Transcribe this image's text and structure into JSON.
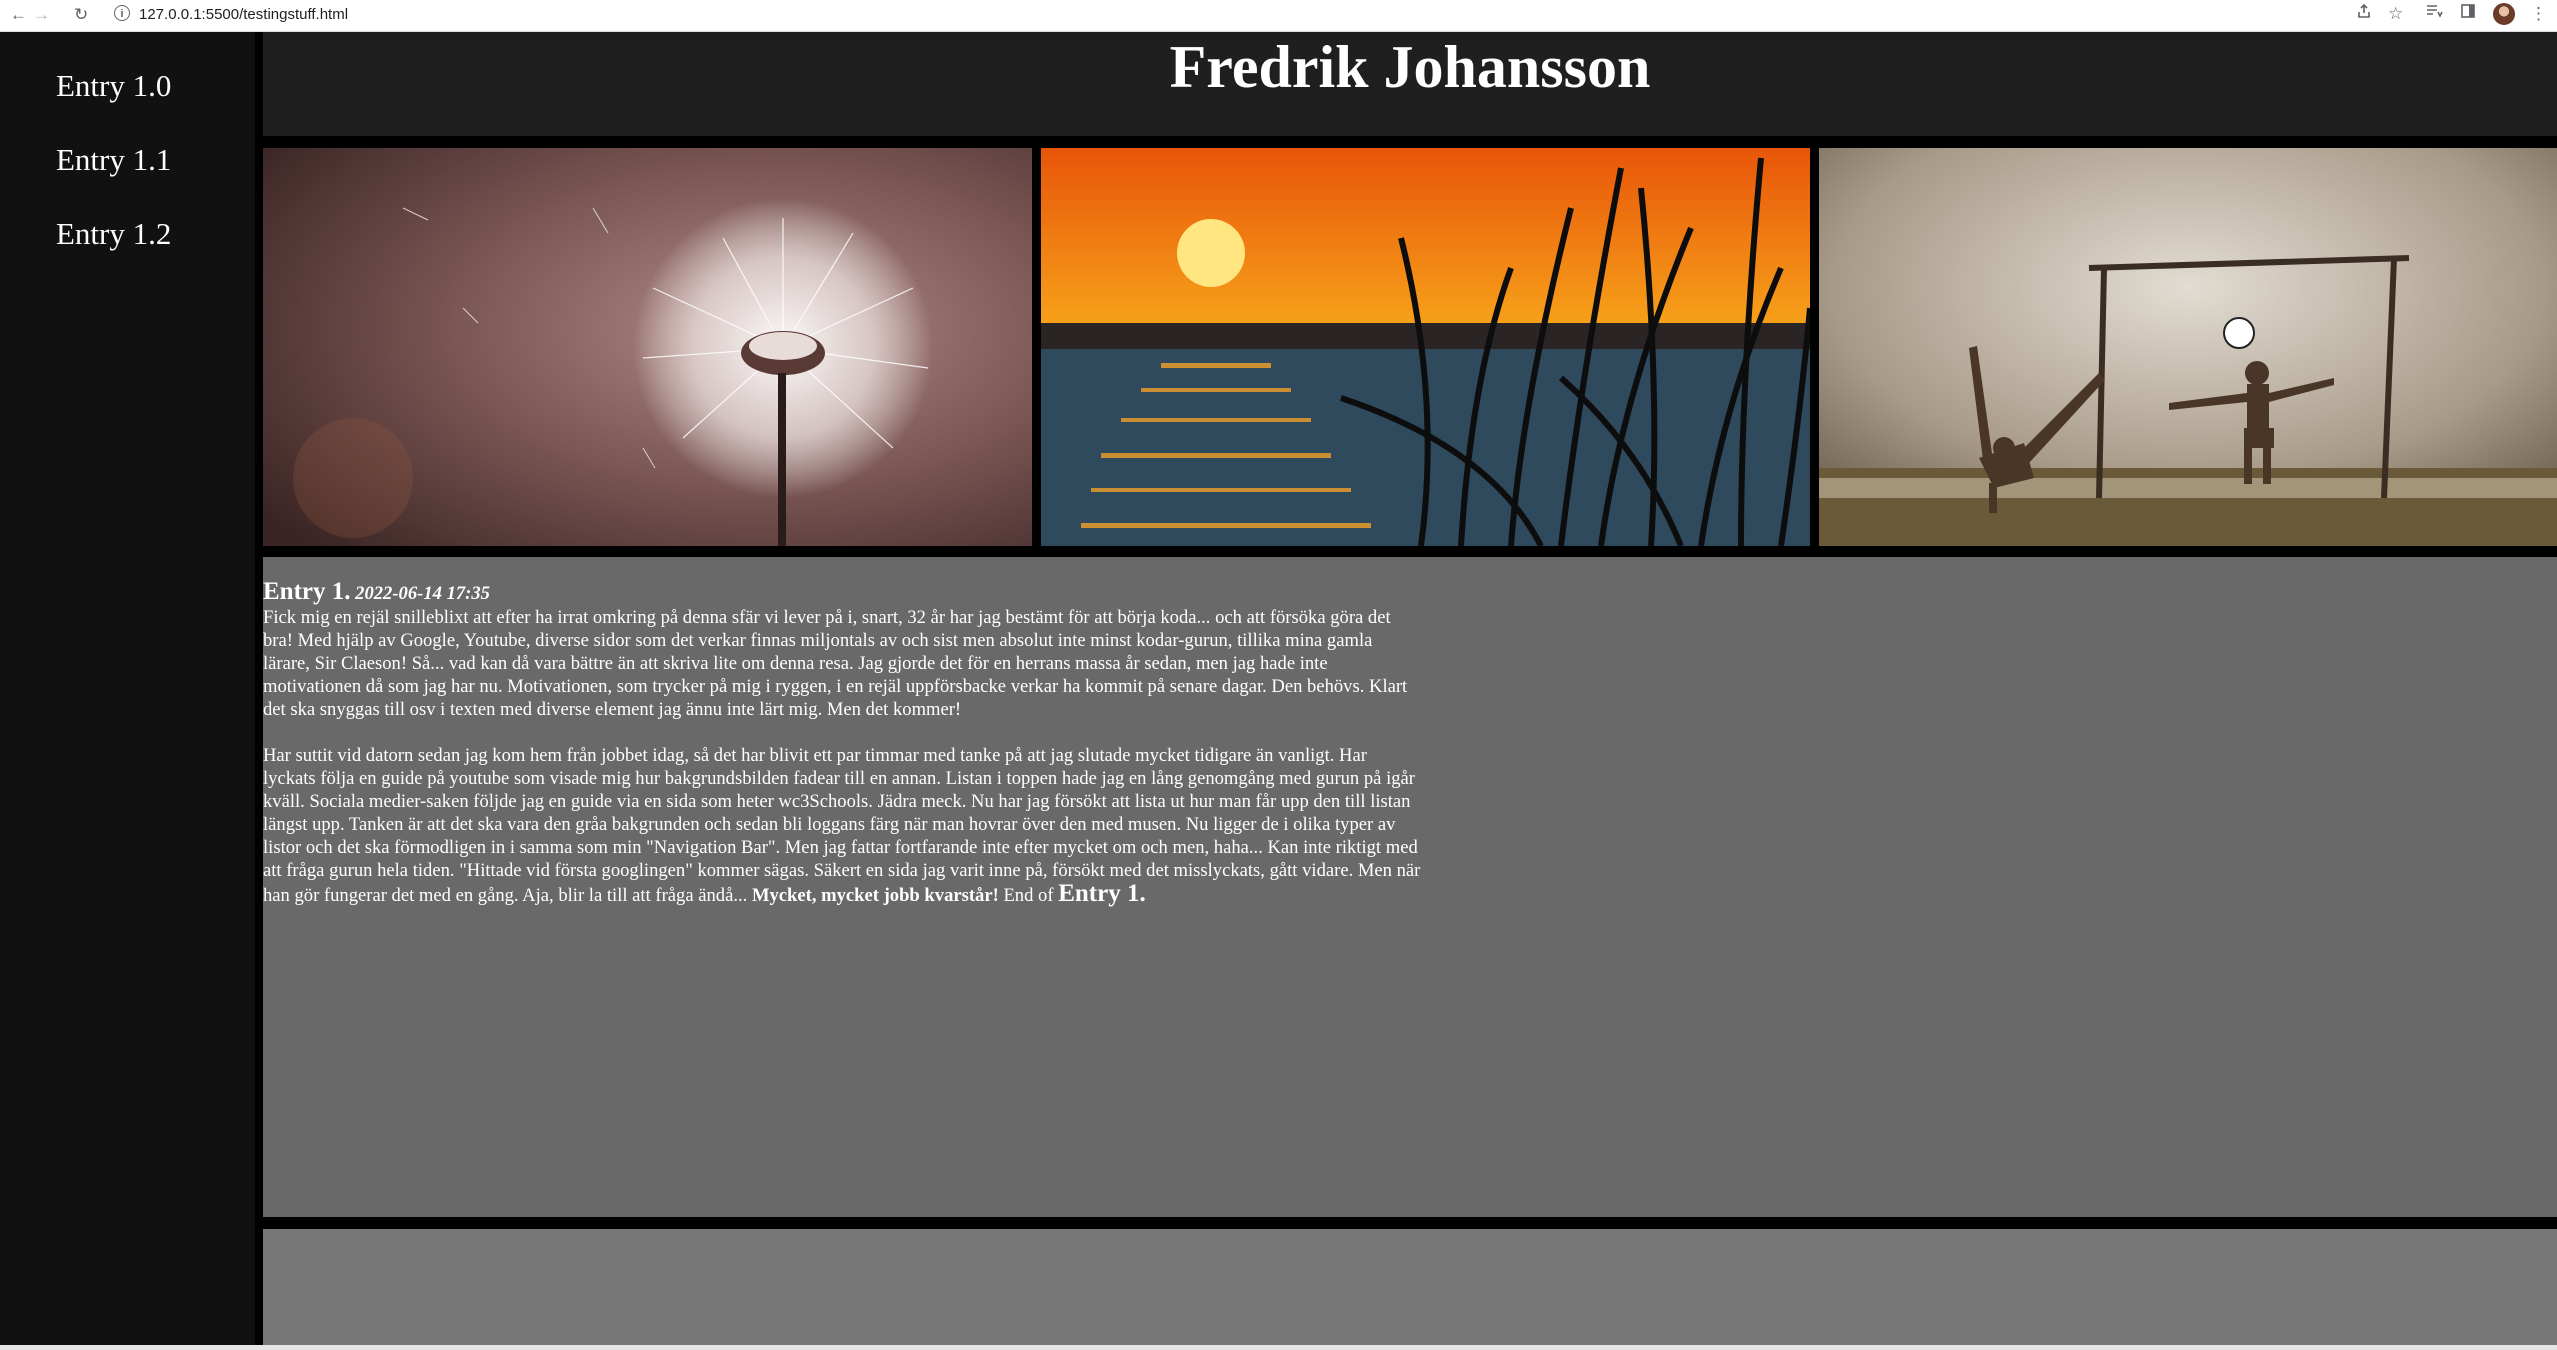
{
  "browser": {
    "url": "127.0.0.1:5500/testingstuff.html",
    "icons": [
      "back-arrow-icon",
      "forward-arrow-icon",
      "reload-icon",
      "info-icon",
      "share-icon",
      "star-icon",
      "reading-list-icon",
      "side-panel-icon",
      "profile-avatar",
      "kebab-menu-icon"
    ]
  },
  "sidebar": {
    "items": [
      {
        "label": "Entry 1.0"
      },
      {
        "label": "Entry 1.1"
      },
      {
        "label": "Entry 1.2"
      }
    ]
  },
  "header": {
    "title": "Fredrik Johansson"
  },
  "photos": [
    {
      "subject": "dandelion"
    },
    {
      "subject": "sunset-reeds"
    },
    {
      "subject": "kids-football"
    }
  ],
  "article": {
    "heading": "Entry 1.",
    "date": "2022-06-14 17:35",
    "paragraph1": "Fick mig en rejäl snilleblixt att efter ha irrat omkring på denna sfär vi lever på i, snart, 32 år har jag bestämt för att börja koda... och att försöka göra det bra! Med hjälp av Google, Youtube, diverse sidor som det verkar finnas miljontals av och sist men absolut inte minst kodar-gurun, tillika mina gamla lärare, Sir Claeson! Så... vad kan då vara bättre än att skriva lite om denna resa. Jag gjorde det för en herrans massa år sedan, men jag hade inte motivationen då som jag har nu. Motivationen, som trycker på mig i ryggen, i en rejäl uppförsbacke verkar ha kommit på senare dagar. Den behövs. Klart det ska snyggas till osv i texten med diverse element jag ännu inte lärt mig. Men det kommer!",
    "paragraph2": "Har suttit vid datorn sedan jag kom hem från jobbet idag, så det har blivit ett par timmar med tanke på att jag slutade mycket tidigare än vanligt. Har lyckats följa en guide på youtube som visade mig hur bakgrundsbilden fadear till en annan. Listan i toppen hade jag en lång genomgång med gurun på igår kväll. Sociala medier-saken följde jag en guide via en sida som heter wc3Schools. Jädra meck. Nu har jag försökt att lista ut hur man får upp den till listan längst upp. Tanken är att det ska vara den gråa bakgrunden och sedan bli loggans färg när man hovrar över den med musen. Nu ligger de i olika typer av listor och det ska förmodligen in i samma som min \"Navigation Bar\". Men jag fattar fortfarande inte efter mycket om och men, haha... Kan inte riktigt med att fråga gurun hela tiden. \"Hittade vid första googlingen\" kommer sägas. Säkert en sida jag varit inne på, försökt med det misslyckats, gått vidare. Men när han gör fungerar det med en gång. Aja, blir la till att fråga ändå...",
    "emphasis": "Mycket, mycket jobb kvarstår!",
    "end_text": "End of",
    "end_entry": "Entry 1."
  },
  "colors": {
    "sidebar_bg": "#111111",
    "header_bg": "#1f1f1f",
    "content_bg": "#696969",
    "footer_bg": "#777777",
    "text": "#ffffff"
  }
}
